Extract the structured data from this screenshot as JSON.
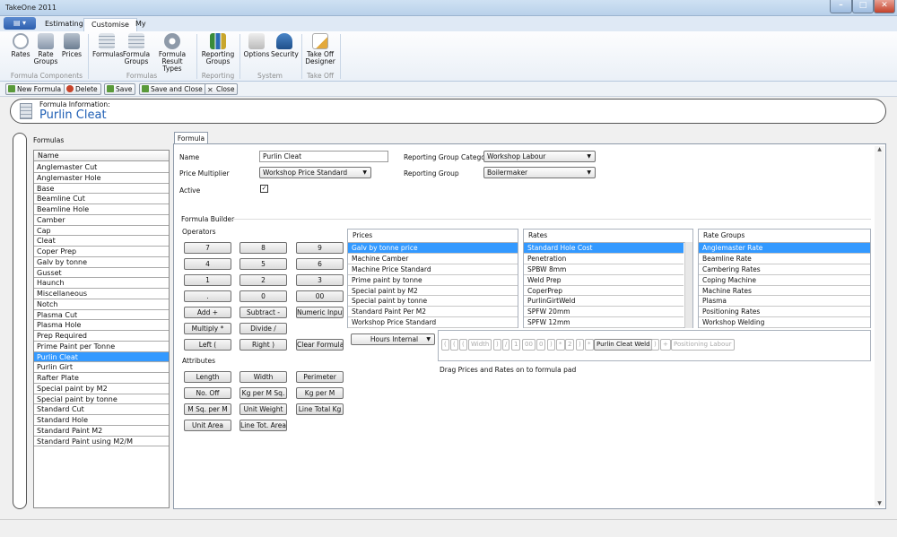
{
  "window": {
    "title": "TakeOne 2011"
  },
  "tabs": [
    {
      "label": "Estimating"
    },
    {
      "label": "Customise"
    },
    {
      "label": "My"
    }
  ],
  "ribbon": {
    "groups": [
      {
        "label": "Formula Components",
        "buttons": [
          {
            "label": "Rates"
          },
          {
            "label": "Rate Groups"
          },
          {
            "label": "Prices"
          }
        ]
      },
      {
        "label": "Formulas",
        "buttons": [
          {
            "label": "Formulas"
          },
          {
            "label": "Formula Groups"
          },
          {
            "label": "Formula Result Types"
          }
        ]
      },
      {
        "label": "Reporting",
        "buttons": [
          {
            "label": "Reporting Groups"
          }
        ]
      },
      {
        "label": "System",
        "buttons": [
          {
            "label": "Options"
          },
          {
            "label": "Security"
          }
        ]
      },
      {
        "label": "Take Off",
        "buttons": [
          {
            "label": "Take Off Designer"
          }
        ]
      }
    ]
  },
  "toolbar": {
    "new": "New Formula",
    "delete": "Delete",
    "save": "Save",
    "save_close": "Save and Close",
    "close": "Close"
  },
  "info": {
    "caption": "Formula Information:",
    "title": "Purlin Cleat"
  },
  "formulas": {
    "label": "Formulas",
    "header": "Name",
    "items": [
      "Anglemaster Cut",
      "Anglemaster Hole",
      "Base",
      "Beamline Cut",
      "Beamline Hole",
      "Camber",
      "Cap",
      "Cleat",
      "Coper Prep",
      "Galv by tonne",
      "Gusset",
      "Haunch",
      "Miscellaneous",
      "Notch",
      "Plasma Cut",
      "Plasma Hole",
      "Prep Required",
      "Prime Paint per Tonne",
      "Purlin Cleat",
      "Purlin Girt",
      "Rafter Plate",
      "Special paint by M2",
      "Special paint by tonne",
      "Standard Cut",
      "Standard Hole",
      "Standard Paint M2",
      "Standard Paint using M2/M"
    ],
    "selected": "Purlin Cleat"
  },
  "form": {
    "tab": "Formula",
    "name_label": "Name",
    "name_value": "Purlin Cleat",
    "price_mult_label": "Price Multiplier",
    "price_mult_value": "Workshop Price Standard",
    "active_label": "Active",
    "active_checked": "✓",
    "rgc_label": "Reporting Group Category",
    "rgc_value": "Workshop Labour",
    "rg_label": "Reporting Group",
    "rg_value": "Boilermaker"
  },
  "builder": {
    "label": "Formula Builder",
    "operators_label": "Operators",
    "operators": [
      "7",
      "8",
      "9",
      "4",
      "5",
      "6",
      "1",
      "2",
      "3",
      ".",
      "0",
      "00",
      "Add +",
      "Subtract -",
      "Numeric Input",
      "Multiply *",
      "Divide /",
      "Left (",
      "Right )",
      "Clear Formula"
    ],
    "attributes_label": "Attributes",
    "attributes": [
      "Length",
      "Width",
      "Perimeter",
      "No. Off",
      "Kg per M Sq.",
      "Kg per M",
      "M Sq. per M",
      "Unit Weight",
      "Line Total Kg",
      "Unit Area",
      "Line Tot. Area"
    ],
    "hours_value": "Hours Internal",
    "pad_chips": [
      "(",
      "(",
      "(",
      "Width",
      ")",
      "/",
      "1",
      "00",
      "0",
      ")",
      "*",
      "2",
      ")",
      "*",
      "Purlin Cleat Weld",
      ")",
      "+",
      "Positioning Labour"
    ],
    "hint": "Drag Prices and Rates on to formula pad"
  },
  "prices": {
    "header": "Prices",
    "items": [
      "Galv by tonne price",
      "Machine Camber",
      "Machine Price Standard",
      "Prime paint by tonne",
      "Special paint by M2",
      "Special paint by tonne",
      "Standard Paint Per M2",
      "Workshop Price Standard"
    ],
    "selected": "Galv by tonne price"
  },
  "rates": {
    "header": "Rates",
    "items": [
      "Standard Hole Cost",
      "Penetration",
      "SPBW 8mm",
      "Weld Prep",
      "CoperPrep",
      "PurlinGirtWeld",
      "SPFW 20mm",
      "SPFW 12mm"
    ],
    "selected": "Standard Hole Cost"
  },
  "rate_groups": {
    "header": "Rate Groups",
    "items": [
      "Anglemaster Rate",
      "Beamline Rate",
      "Cambering Rates",
      "Coping Machine",
      "Machine Rates",
      "Plasma",
      "Positioning Rates",
      "Workshop Welding"
    ],
    "selected": "Anglemaster Rate"
  },
  "colors": {
    "accent": "#3399ff",
    "title_blue": "#1f5fb5"
  }
}
